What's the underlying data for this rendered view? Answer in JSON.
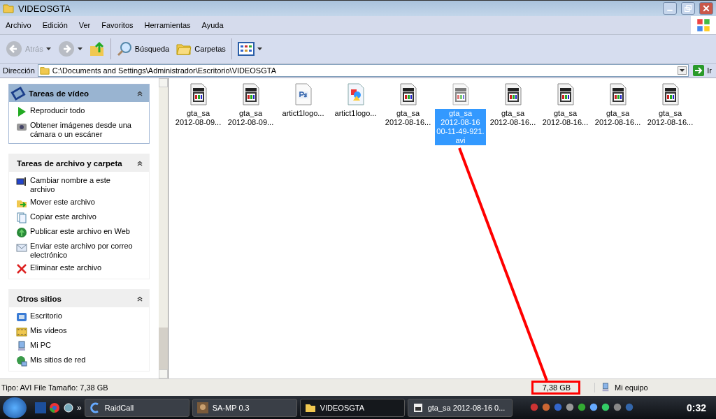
{
  "window": {
    "title": "VIDEOSGTA"
  },
  "menu": [
    "Archivo",
    "Edición",
    "Ver",
    "Favoritos",
    "Herramientas",
    "Ayuda"
  ],
  "toolbar": [
    {
      "kind": "back",
      "label": "Atrás",
      "disabled": true
    },
    {
      "kind": "forward"
    },
    {
      "kind": "up"
    },
    {
      "kind": "search",
      "label": "Búsqueda"
    },
    {
      "kind": "folders",
      "label": "Carpetas"
    },
    {
      "kind": "views"
    }
  ],
  "address": {
    "label": "Dirección",
    "path": "C:\\Documents and Settings\\Administrador\\Escritorio\\VIDEOSGTA",
    "go": "Ir"
  },
  "sidebar": {
    "panels": [
      {
        "kind": "special",
        "title": "Tareas de vídeo",
        "items": [
          "Reproducir todo",
          "Obtener imágenes desde una cámara o un escáner"
        ]
      },
      {
        "kind": "plain",
        "title": "Tareas de archivo y carpeta",
        "items": [
          "Cambiar nombre a este archivo",
          "Mover este archivo",
          "Copiar este archivo",
          "Publicar este archivo en Web",
          "Enviar este archivo por correo electrónico",
          "Eliminar este archivo"
        ]
      },
      {
        "kind": "plain",
        "title": "Otros sitios",
        "items": [
          "Escritorio",
          "Mis vídeos",
          "Mi PC",
          "Mis sitios de red"
        ]
      }
    ]
  },
  "files": [
    {
      "kind": "video",
      "lines": [
        "gta_sa",
        "2012-08-09..."
      ],
      "selected": false
    },
    {
      "kind": "video",
      "lines": [
        "gta_sa",
        "2012-08-09..."
      ],
      "selected": false
    },
    {
      "kind": "psd",
      "lines": [
        "artict1logo..."
      ],
      "selected": false
    },
    {
      "kind": "image",
      "lines": [
        "artict1logo..."
      ],
      "selected": false
    },
    {
      "kind": "video",
      "lines": [
        "gta_sa",
        "2012-08-16..."
      ],
      "selected": false
    },
    {
      "kind": "video",
      "lines": [
        "gta_sa",
        "2012-08-16",
        "00-11-49-921.",
        "avi"
      ],
      "selected": true
    },
    {
      "kind": "video",
      "lines": [
        "gta_sa",
        "2012-08-16..."
      ],
      "selected": false
    },
    {
      "kind": "video",
      "lines": [
        "gta_sa",
        "2012-08-16..."
      ],
      "selected": false
    },
    {
      "kind": "video",
      "lines": [
        "gta_sa",
        "2012-08-16..."
      ],
      "selected": false
    },
    {
      "kind": "video",
      "lines": [
        "gta_sa",
        "2012-08-16..."
      ],
      "selected": false
    }
  ],
  "status_bar": {
    "info": "Tipo: AVI File Tamaño: 7,38 GB",
    "size": {
      "text": "7,38 GB",
      "highlighted": true
    },
    "location": "Mi equipo"
  },
  "taskbar": {
    "buttons": [
      {
        "label": "RaidCall",
        "selected": false
      },
      {
        "label": "SA-MP 0.3",
        "selected": false
      },
      {
        "label": "VIDEOSGTA",
        "selected": true
      },
      {
        "label": "gta_sa 2012-08-16 0...",
        "selected": false
      }
    ],
    "chevron": "»",
    "clock": "0:32"
  }
}
